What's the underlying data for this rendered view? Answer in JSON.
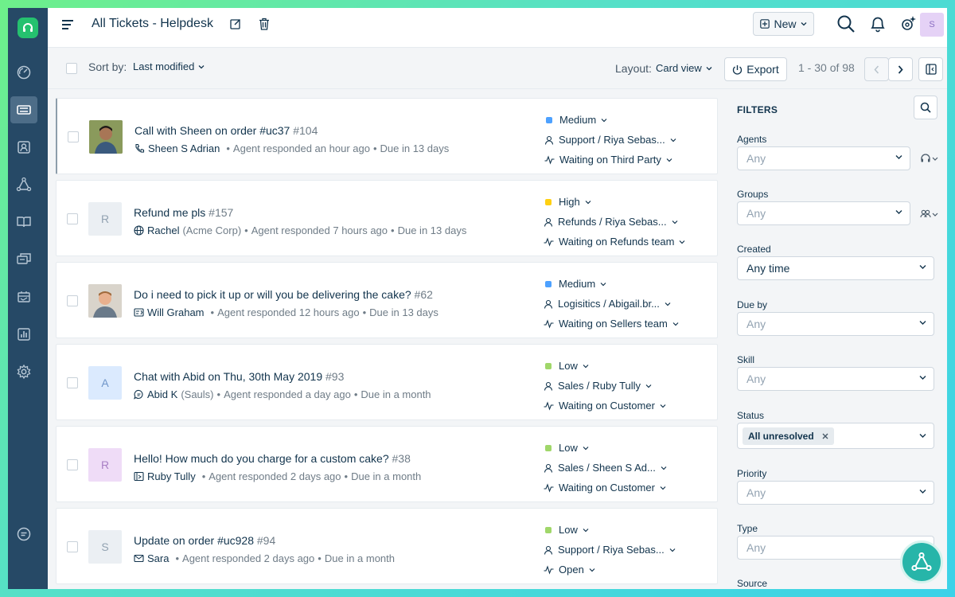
{
  "header": {
    "title": "All Tickets - Helpdesk",
    "new_label": "New",
    "avatar_initial": "S"
  },
  "toolbar": {
    "sort_label": "Sort by:",
    "sort_value": "Last modified",
    "layout_label": "Layout:",
    "layout_value": "Card view",
    "export_label": "Export",
    "pagination": "1 - 30 of 98"
  },
  "tickets": [
    {
      "subject": "Call with Sheen on order #uc37",
      "id": "#104",
      "requester": "Sheen S Adrian",
      "company": "",
      "source_icon": "phone-icon",
      "meta": "Agent responded an hour ago",
      "due": "Due in 13 days",
      "priority": "Medium",
      "priority_color": "#4da1ff",
      "group_agent": "Support / Riya Sebas...",
      "status": "Waiting on Third Party",
      "avatar_initial": ""
    },
    {
      "subject": "Refund me pls",
      "id": "#157",
      "requester": "Rachel",
      "company": "(Acme Corp)",
      "source_icon": "globe-icon",
      "meta": "Agent responded 7 hours ago",
      "due": "Due in 13 days",
      "priority": "High",
      "priority_color": "#ffd012",
      "group_agent": "Refunds / Riya Sebas...",
      "status": "Waiting on Refunds team",
      "avatar_initial": "R"
    },
    {
      "subject": "Do i need to pick it up or will you be delivering the cake?",
      "id": "#62",
      "requester": "Will Graham",
      "company": "",
      "source_icon": "feedback-icon",
      "meta": "Agent responded 12 hours ago",
      "due": "Due in 13 days",
      "priority": "Medium",
      "priority_color": "#4da1ff",
      "group_agent": "Logisitics / Abigail.br...",
      "status": "Waiting on Sellers team",
      "avatar_initial": ""
    },
    {
      "subject": "Chat with Abid on Thu, 30th May 2019",
      "id": "#93",
      "requester": "Abid K",
      "company": "(Sauls)",
      "source_icon": "chat-icon",
      "meta": "Agent responded a day ago",
      "due": "Due in a month",
      "priority": "Low",
      "priority_color": "#a0d76a",
      "group_agent": "Sales / Ruby Tully",
      "status": "Waiting on Customer",
      "avatar_initial": "A"
    },
    {
      "subject": "Hello! How much do you charge for a custom cake?",
      "id": "#38",
      "requester": "Ruby Tully",
      "company": "",
      "source_icon": "portal-icon",
      "meta": "Agent responded 2 days ago",
      "due": "Due in a month",
      "priority": "Low",
      "priority_color": "#a0d76a",
      "group_agent": "Sales / Sheen S Ad...",
      "status": "Waiting on Customer",
      "avatar_initial": "R"
    },
    {
      "subject": "Update on order #uc928",
      "id": "#94",
      "requester": "Sara",
      "company": "",
      "source_icon": "email-icon",
      "meta": "Agent responded 2 days ago",
      "due": "Due in a month",
      "priority": "Low",
      "priority_color": "#a0d76a",
      "group_agent": "Support / Riya Sebas...",
      "status": "Open",
      "avatar_initial": "S"
    }
  ],
  "filters": {
    "title": "FILTERS",
    "agents": {
      "label": "Agents",
      "value": "Any"
    },
    "groups": {
      "label": "Groups",
      "value": "Any"
    },
    "created": {
      "label": "Created",
      "value": "Any time"
    },
    "due_by": {
      "label": "Due by",
      "value": "Any"
    },
    "skill": {
      "label": "Skill",
      "value": "Any"
    },
    "status": {
      "label": "Status",
      "chip": "All unresolved"
    },
    "priority": {
      "label": "Priority",
      "value": "Any"
    },
    "type": {
      "label": "Type",
      "value": "Any"
    },
    "source": {
      "label": "Source"
    }
  },
  "colors": {
    "sidebar": "#264966",
    "logo_green": "#25c16f",
    "fab": "#27b5a9"
  }
}
